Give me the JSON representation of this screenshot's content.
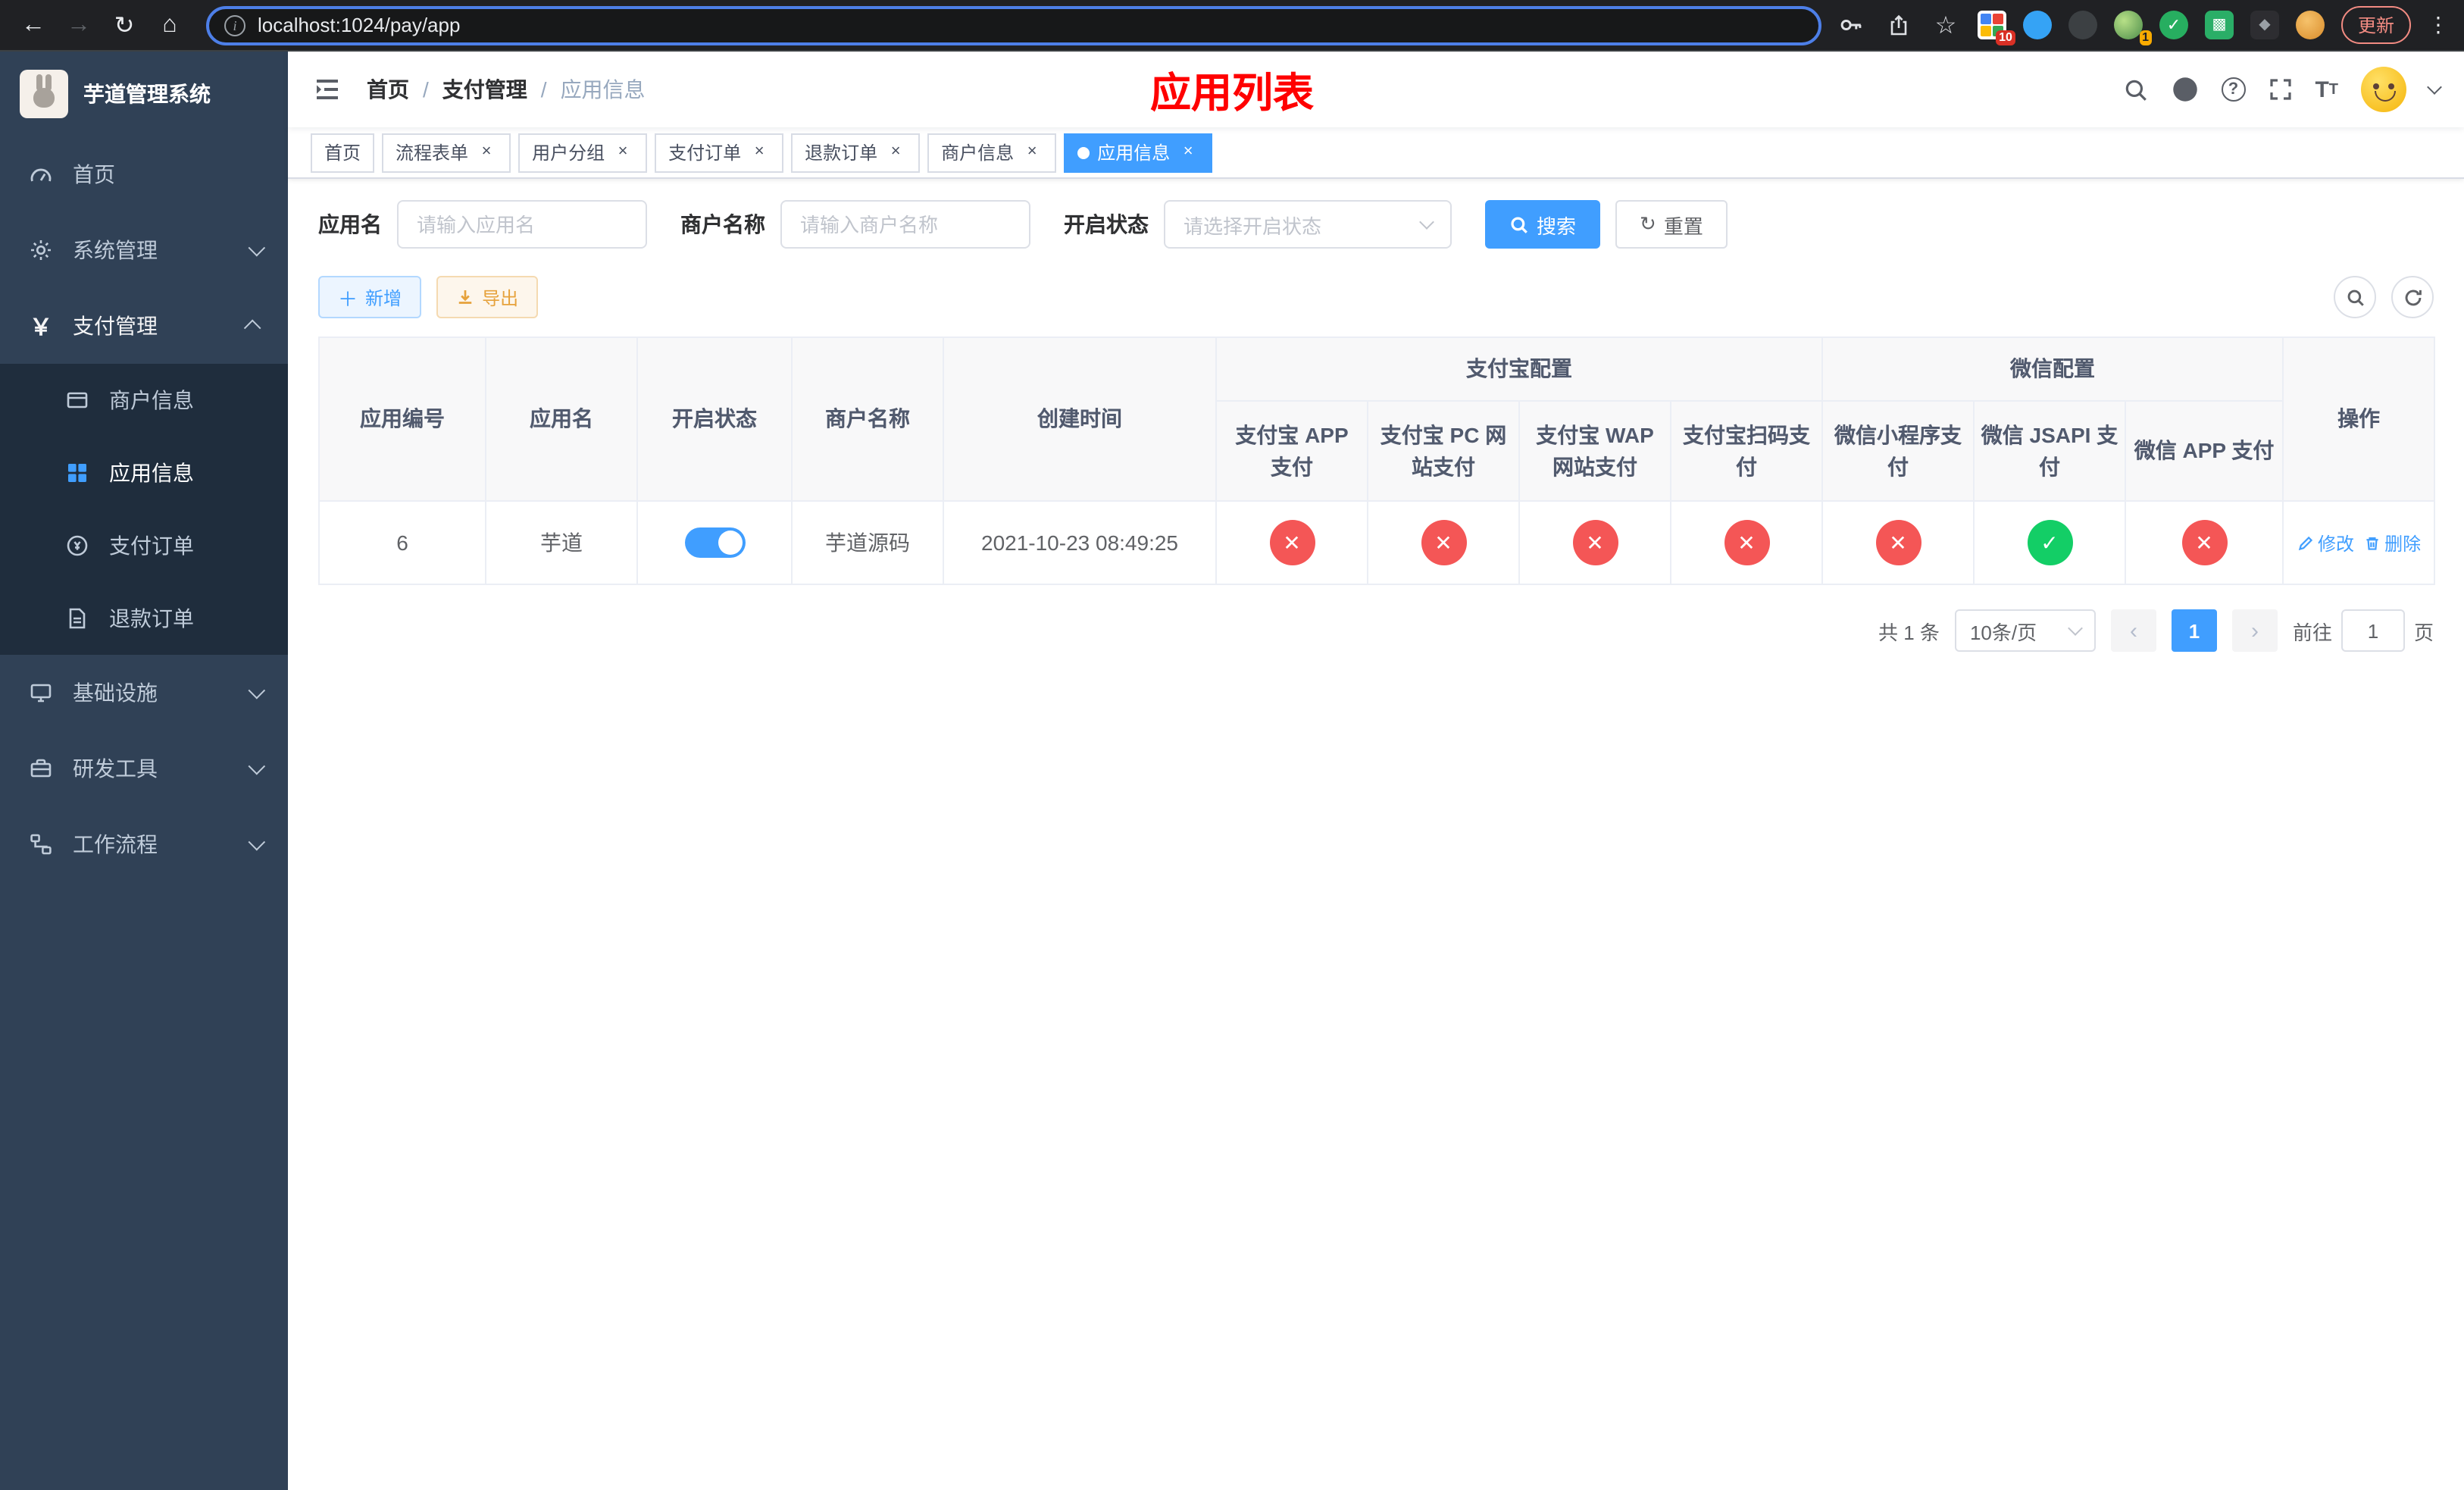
{
  "browser": {
    "url": "localhost:1024/pay/app",
    "update_button": "更新",
    "extension_badges": {
      "grid": "10",
      "avatar": "1"
    }
  },
  "sidebar": {
    "logo_title": "芋道管理系统",
    "items": {
      "home": "首页",
      "system": "系统管理",
      "payment": "支付管理",
      "infra": "基础设施",
      "devtools": "研发工具",
      "workflow": "工作流程"
    },
    "payment_children": {
      "merchant": "商户信息",
      "app": "应用信息",
      "order": "支付订单",
      "refund": "退款订单"
    }
  },
  "header": {
    "breadcrumb": {
      "level1": "首页",
      "level2": "支付管理",
      "level3": "应用信息"
    },
    "page_title": "应用列表"
  },
  "tabs": {
    "home": "首页",
    "flow_form": "流程表单",
    "user_group": "用户分组",
    "pay_order": "支付订单",
    "refund_order": "退款订单",
    "merchant_info": "商户信息",
    "app_info": "应用信息"
  },
  "filters": {
    "app_name_label": "应用名",
    "app_name_placeholder": "请输入应用名",
    "merchant_label": "商户名称",
    "merchant_placeholder": "请输入商户名称",
    "status_label": "开启状态",
    "status_placeholder": "请选择开启状态",
    "search_button": "搜索",
    "reset_button": "重置"
  },
  "toolbar": {
    "add": "新增",
    "export": "导出"
  },
  "table": {
    "headers": {
      "app_id": "应用编号",
      "app_name": "应用名",
      "status": "开启状态",
      "merchant_name": "商户名称",
      "created_at": "创建时间",
      "alipay_group": "支付宝配置",
      "alipay_app": "支付宝 APP 支付",
      "alipay_pc": "支付宝 PC 网站支付",
      "alipay_wap": "支付宝 WAP 网站支付",
      "alipay_qr": "支付宝扫码支付",
      "wechat_group": "微信配置",
      "wechat_mini": "微信小程序支付",
      "wechat_jsapi": "微信 JSAPI 支付",
      "wechat_app": "微信 APP 支付",
      "ops": "操作"
    },
    "row": {
      "id": "6",
      "name": "芋道",
      "enabled": true,
      "merchant": "芋道源码",
      "created_at": "2021-10-23 08:49:25",
      "channels": [
        false,
        false,
        false,
        false,
        false,
        true,
        false
      ],
      "edit": "修改",
      "delete": "删除"
    }
  },
  "pagination": {
    "total": "共 1 条",
    "page_size": "10条/页",
    "current": "1",
    "goto_label": "前往",
    "goto_value": "1",
    "goto_unit": "页"
  },
  "colors": {
    "primary": "#409EFF",
    "success": "#13ce66",
    "danger": "#f45656",
    "title": "#ff0000"
  }
}
